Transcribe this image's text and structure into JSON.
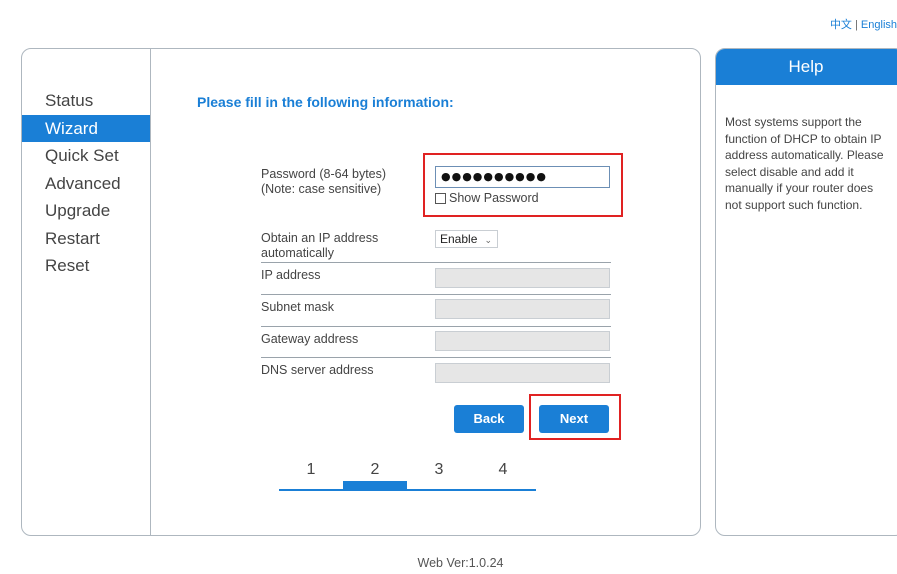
{
  "lang": {
    "chinese": "中文",
    "separator": "|",
    "english": "English"
  },
  "sidebar": {
    "items": [
      {
        "label": "Status"
      },
      {
        "label": "Wizard"
      },
      {
        "label": "Quick Set"
      },
      {
        "label": "Advanced"
      },
      {
        "label": "Upgrade"
      },
      {
        "label": "Restart"
      },
      {
        "label": "Reset"
      }
    ],
    "active": "Wizard"
  },
  "form": {
    "title": "Please fill in the following information:",
    "password": {
      "label_line1": "Password (8-64 bytes)",
      "label_line2": "(Note: case sensitive)",
      "value_masked": "●●●●●●●●●●",
      "show_password_label": "Show Password",
      "show_password_checked": false
    },
    "dhcp": {
      "label_line1": "Obtain an IP address",
      "label_line2": "automatically",
      "selected": "Enable"
    },
    "ip_address": {
      "label": "IP address",
      "value": ""
    },
    "subnet_mask": {
      "label": "Subnet mask",
      "value": ""
    },
    "gateway": {
      "label": "Gateway address",
      "value": ""
    },
    "dns": {
      "label": "DNS server address",
      "value": ""
    }
  },
  "buttons": {
    "back": "Back",
    "next": "Next"
  },
  "steps": {
    "labels": [
      "1",
      "2",
      "3",
      "4"
    ],
    "current": 2
  },
  "help": {
    "title": "Help",
    "text": "Most systems support the function of DHCP to obtain IP address automatically. Please select disable and add it manually if your router does not support such function."
  },
  "footer": {
    "version": "Web Ver:1.0.24"
  },
  "colors": {
    "accent": "#1a7fd6",
    "highlight": "#e02222"
  }
}
